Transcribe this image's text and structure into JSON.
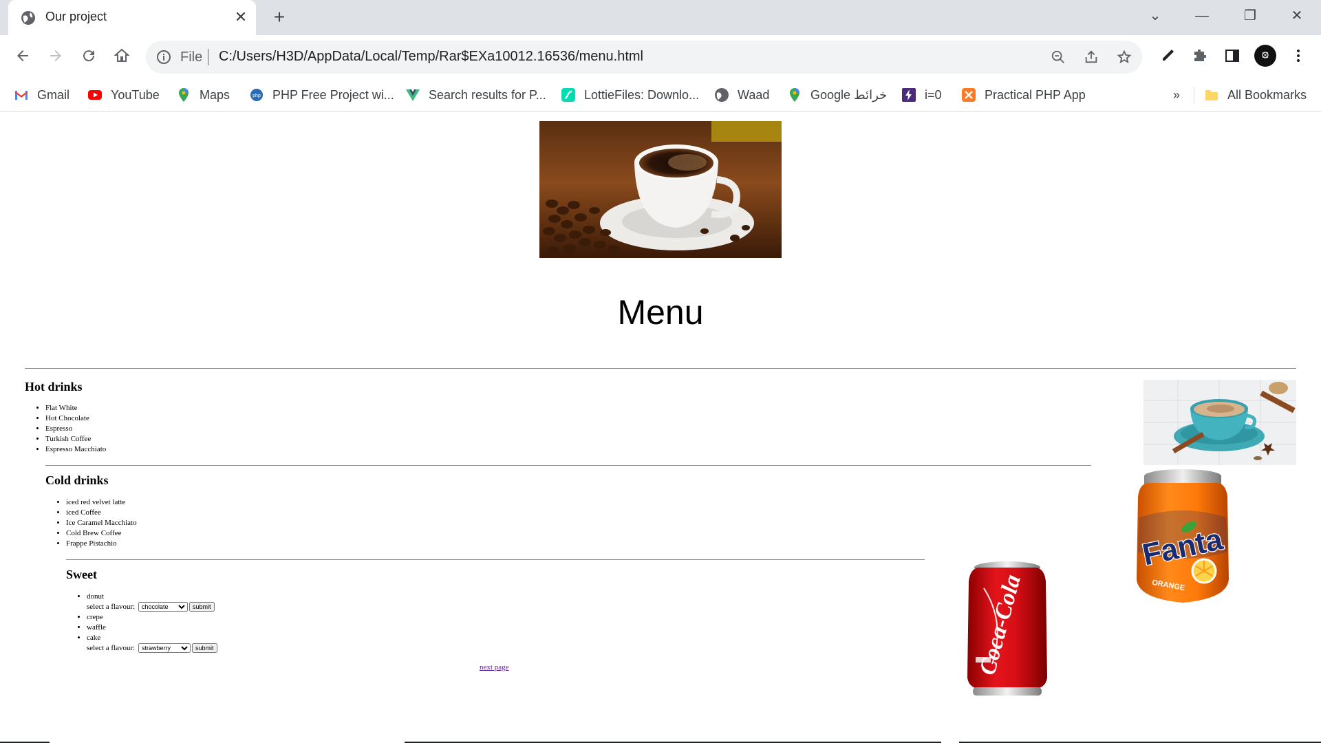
{
  "browser": {
    "tab_title": "Our project",
    "address": {
      "scheme_label": "File",
      "url": "C:/Users/H3D/AppData/Local/Temp/Rar$EXa10012.16536/menu.html"
    },
    "bookmarks": [
      {
        "label": "Gmail",
        "icon": "gmail-icon"
      },
      {
        "label": "YouTube",
        "icon": "youtube-icon"
      },
      {
        "label": "Maps",
        "icon": "maps-icon"
      },
      {
        "label": "PHP Free Project wi...",
        "icon": "php-icon"
      },
      {
        "label": "Search results for P...",
        "icon": "vue-icon"
      },
      {
        "label": "LottieFiles: Downlo...",
        "icon": "lottie-icon"
      },
      {
        "label": "Waad",
        "icon": "globe-icon"
      },
      {
        "label": "Google خرائط",
        "icon": "maps-icon"
      },
      {
        "label": "i=0",
        "icon": "bolt-icon"
      },
      {
        "label": "Practical PHP App",
        "icon": "xampp-icon"
      }
    ],
    "overflow_label": "»",
    "all_bookmarks_label": "All Bookmarks"
  },
  "page": {
    "heading": "Menu",
    "hot_drinks": {
      "title": "Hot drinks",
      "items": [
        "Flat White",
        "Hot Chocolate",
        "Espresso",
        "Turkish Coffee",
        "Espresso Macchiato"
      ]
    },
    "cold_drinks": {
      "title": "Cold drinks",
      "items": [
        "iced red velvet latte",
        "iced Coffee",
        "Ice Caramel Macchiato",
        "Cold Brew Coffee",
        "Frappe Pistachio"
      ]
    },
    "sweet": {
      "title": "Sweet",
      "items": [
        "donut",
        "crepe",
        "waffle",
        "cake"
      ],
      "flavour_label": "select a flavour:",
      "donut_flavour": "chocolate",
      "cake_flavour": "strawberry",
      "submit_label": "submit"
    },
    "next_link": "next page",
    "can_text": {
      "coke": "Coca-Cola",
      "fanta": "Fanta",
      "fanta_sub": "ORANGE"
    }
  }
}
